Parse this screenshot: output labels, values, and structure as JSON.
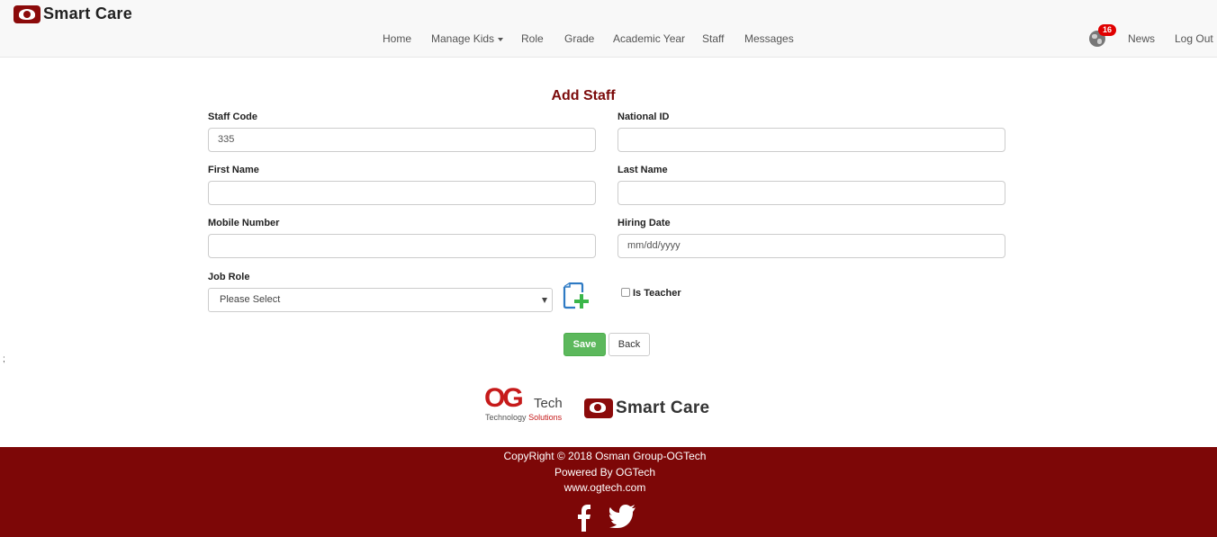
{
  "brand": {
    "name": "Smart Care"
  },
  "nav": {
    "items": [
      "Home",
      "Manage Kids",
      "Role",
      "Grade",
      "Academic Year",
      "Staff",
      "Messages"
    ],
    "notifications_count": "16",
    "news": "News",
    "logout": "Log Out"
  },
  "form": {
    "title": "Add Staff",
    "staff_code": {
      "label": "Staff Code",
      "value": "335"
    },
    "national_id": {
      "label": "National ID",
      "value": ""
    },
    "first_name": {
      "label": "First Name",
      "value": ""
    },
    "last_name": {
      "label": "Last Name",
      "value": ""
    },
    "mobile_number": {
      "label": "Mobile Number",
      "value": ""
    },
    "hiring_date": {
      "label": "Hiring Date",
      "placeholder": "mm/dd/yyyy"
    },
    "job_role": {
      "label": "Job Role",
      "selected": "Please Select"
    },
    "is_teacher": {
      "label": "Is Teacher",
      "checked": false
    },
    "save": "Save",
    "back": "Back"
  },
  "stray_text": ";",
  "logos": {
    "ogtech_letters": "OG",
    "ogtech_word": "Tech",
    "ogtech_tagline_1": "Technology",
    "ogtech_tagline_2": "Solutions",
    "smart_care": "Smart Care"
  },
  "footer": {
    "copyright": "CopyRight © 2018 Osman Group-OGTech",
    "powered": "Powered By OGTech",
    "website": "www.ogtech.com"
  },
  "colors": {
    "brand": "#7b0a0a",
    "footer_bg": "#7d0707",
    "save_button": "#5cb85c",
    "badge": "#e00000"
  }
}
